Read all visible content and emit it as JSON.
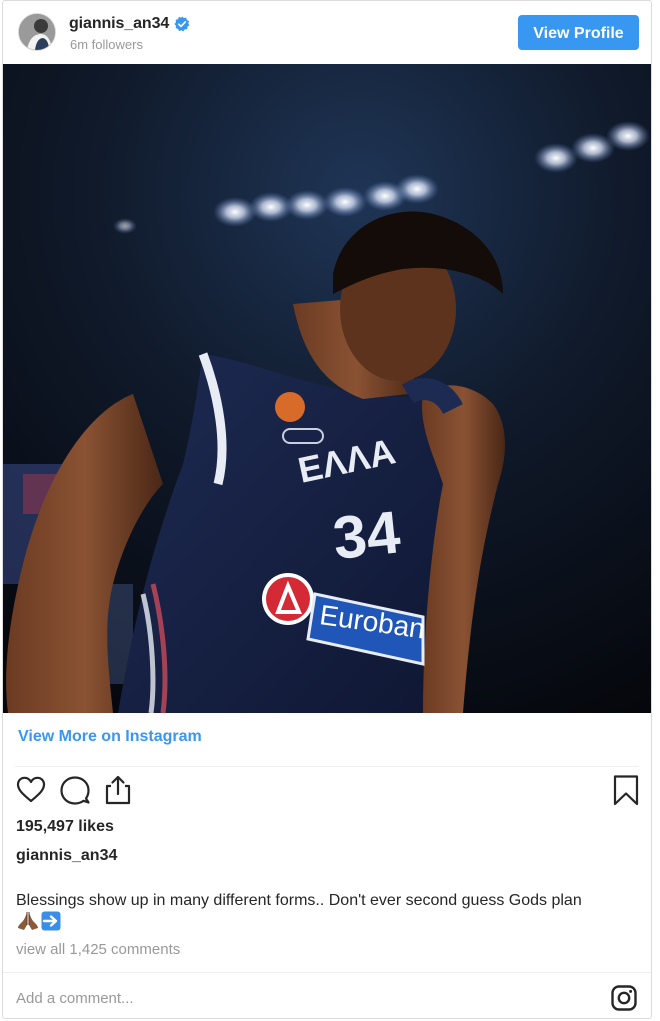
{
  "header": {
    "username": "giannis_an34",
    "followers": "6m followers",
    "verified_icon": "verified-badge-icon",
    "view_profile_label": "View Profile"
  },
  "photo": {
    "jersey_text": "ΕΛΛΑ",
    "jersey_number": "34",
    "sponsor": "Euroban"
  },
  "view_more_label": "View More on Instagram",
  "actions": {
    "like_icon": "heart-icon",
    "comment_icon": "comment-icon",
    "share_icon": "share-icon",
    "save_icon": "bookmark-icon"
  },
  "likes": "195,497 likes",
  "caption": {
    "username": "giannis_an34",
    "text": "Blessings show up in many different forms.. Don't ever second guess Gods plan",
    "emojis": [
      "🙏🏾",
      "➡️"
    ]
  },
  "comments_link": "view all 1,425 comments",
  "comment_input": {
    "placeholder": "Add a comment..."
  },
  "footer_icon": "instagram-logo-icon",
  "colors": {
    "accent": "#3897f0",
    "text": "#262626",
    "muted": "#999999",
    "border": "#dbdbdb"
  }
}
